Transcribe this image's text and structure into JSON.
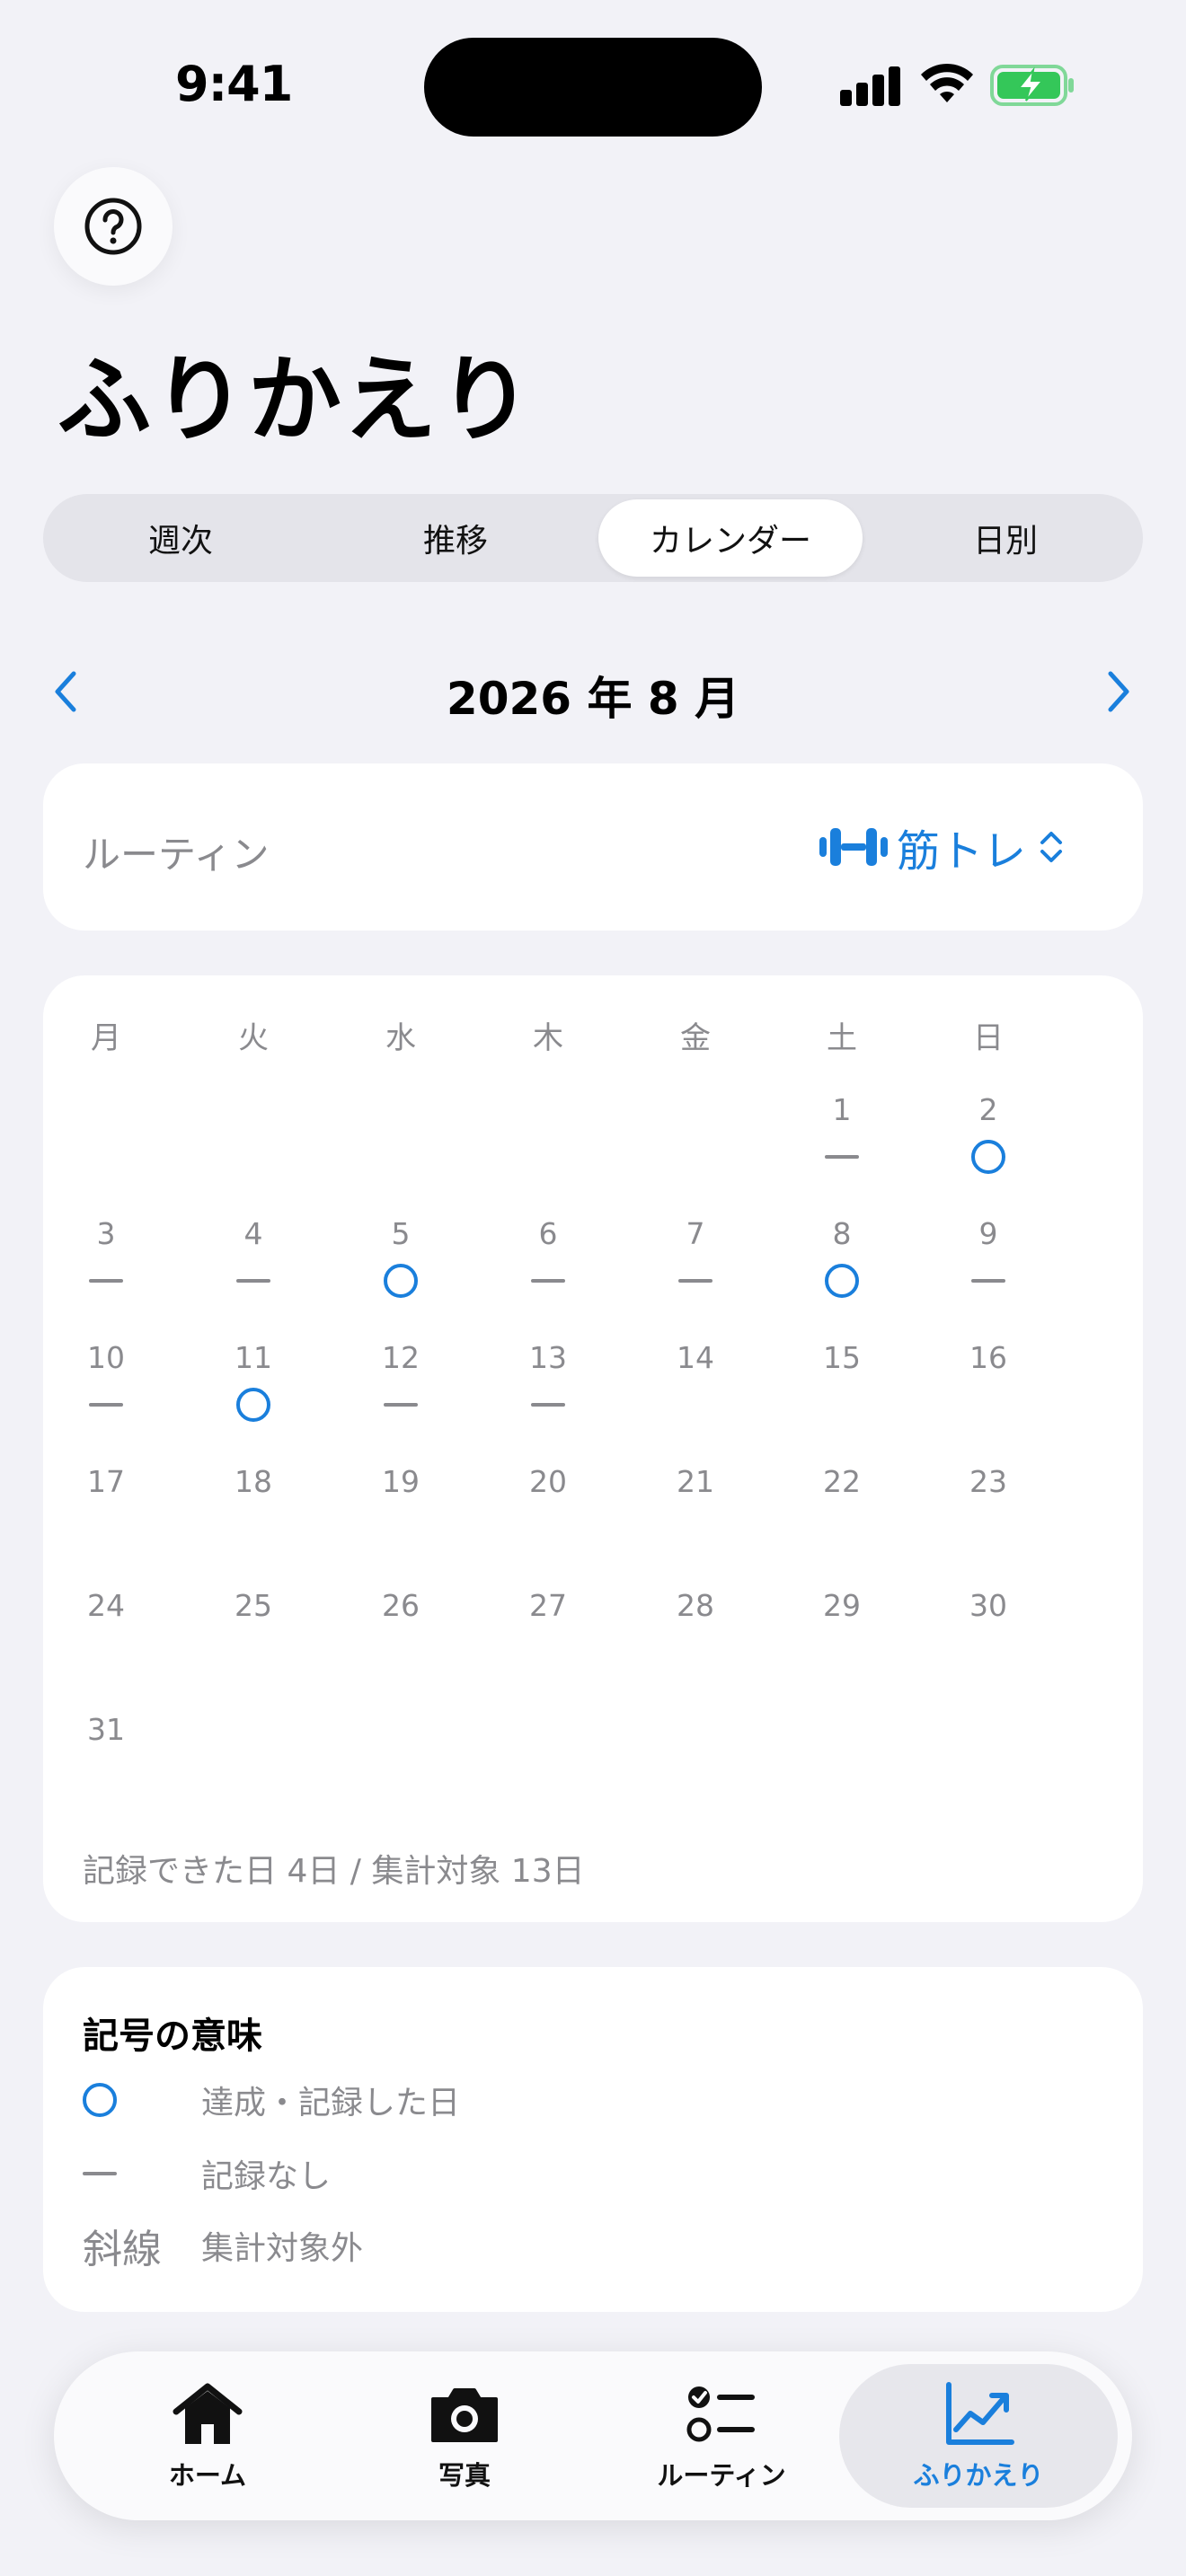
{
  "status_bar": {
    "time": "9:41"
  },
  "header": {
    "title": "ふりかえり"
  },
  "segments": [
    {
      "label": "週次",
      "active": false
    },
    {
      "label": "推移",
      "active": false
    },
    {
      "label": "カレンダー",
      "active": true
    },
    {
      "label": "日別",
      "active": false
    }
  ],
  "month_nav": {
    "label": "2026 年 8 月"
  },
  "routine": {
    "label": "ルーティン",
    "selected": "筋トレ",
    "icon": "dumbbell-icon"
  },
  "calendar": {
    "weekdays": [
      "月",
      "火",
      "水",
      "木",
      "金",
      "土",
      "日"
    ],
    "rows": [
      [
        {
          "d": ""
        },
        {
          "d": ""
        },
        {
          "d": ""
        },
        {
          "d": ""
        },
        {
          "d": ""
        },
        {
          "d": "1",
          "m": "dash"
        },
        {
          "d": "2",
          "m": "circle"
        }
      ],
      [
        {
          "d": "3",
          "m": "dash"
        },
        {
          "d": "4",
          "m": "dash"
        },
        {
          "d": "5",
          "m": "circle"
        },
        {
          "d": "6",
          "m": "dash"
        },
        {
          "d": "7",
          "m": "dash"
        },
        {
          "d": "8",
          "m": "circle"
        },
        {
          "d": "9",
          "m": "dash"
        }
      ],
      [
        {
          "d": "10",
          "m": "dash"
        },
        {
          "d": "11",
          "m": "circle"
        },
        {
          "d": "12",
          "m": "dash"
        },
        {
          "d": "13",
          "m": "dash"
        },
        {
          "d": "14"
        },
        {
          "d": "15"
        },
        {
          "d": "16"
        }
      ],
      [
        {
          "d": "17"
        },
        {
          "d": "18"
        },
        {
          "d": "19"
        },
        {
          "d": "20"
        },
        {
          "d": "21"
        },
        {
          "d": "22"
        },
        {
          "d": "23"
        }
      ],
      [
        {
          "d": "24"
        },
        {
          "d": "25"
        },
        {
          "d": "26"
        },
        {
          "d": "27"
        },
        {
          "d": "28"
        },
        {
          "d": "29"
        },
        {
          "d": "30"
        }
      ],
      [
        {
          "d": "31"
        },
        {
          "d": ""
        },
        {
          "d": ""
        },
        {
          "d": ""
        },
        {
          "d": ""
        },
        {
          "d": ""
        },
        {
          "d": ""
        }
      ]
    ],
    "summary": "記録できた日 4日 / 集計対象 13日"
  },
  "legend": {
    "title": "記号の意味",
    "items": [
      {
        "symbol": "circle",
        "text": "達成・記録した日"
      },
      {
        "symbol": "dash",
        "text": "記録なし"
      },
      {
        "symbol": "斜線",
        "text": "集計対象外"
      }
    ]
  },
  "tabbar": {
    "items": [
      {
        "label": "ホーム",
        "icon": "house-icon",
        "active": false
      },
      {
        "label": "写真",
        "icon": "camera-icon",
        "active": false
      },
      {
        "label": "ルーティン",
        "icon": "checklist-icon",
        "active": false
      },
      {
        "label": "ふりかえり",
        "icon": "chart-icon",
        "active": true
      }
    ]
  },
  "colors": {
    "accent": "#1a7fdc",
    "background": "#f2f2f7",
    "muted": "#8a8a8e",
    "battery": "#34c759"
  }
}
